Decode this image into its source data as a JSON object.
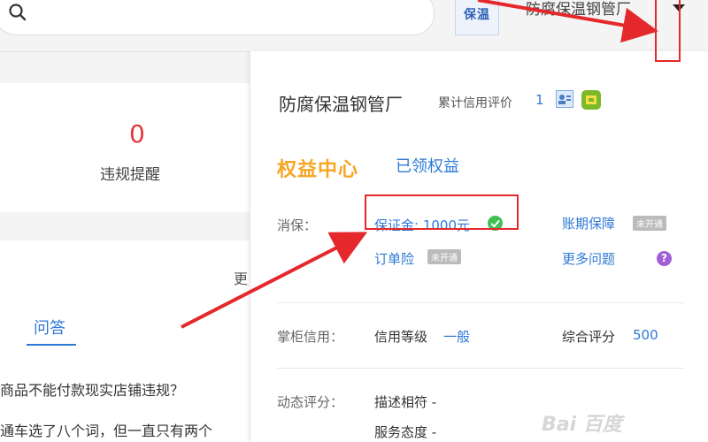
{
  "header": {
    "logo_text": "保温",
    "shop_name": "防腐保温钢管厂"
  },
  "left": {
    "violation_count": "0",
    "violation_label": "违规提醒",
    "more_link": "更",
    "tab_qa": "问答",
    "questions": [
      "商品不能付款现实店铺违规？",
      "通车选了八个词，但一直只有两个"
    ]
  },
  "panel": {
    "shop_name": "防腐保温钢管厂",
    "credit_label": "累计信用评价",
    "credit_value": "1",
    "benefits_title": "权益中心",
    "benefits_claimed": "已领权益",
    "xiaobao_label": "消保：",
    "deposit": "保证金: 1000元",
    "order_insurance": "订单险",
    "not_enabled": "未开通",
    "account_protection": "账期保障",
    "more_questions": "更多问题",
    "shopkeeper_credit_label": "掌柜信用：",
    "credit_level_label": "信用等级",
    "credit_level_value": "一般",
    "overall_score_label": "综合评分",
    "overall_score_value": "500",
    "dynamic_rating_label": "动态评分：",
    "desc_match": "描述相符 -",
    "service_attitude": "服务态度 -"
  },
  "watermark": "Bai 百度",
  "colors": {
    "accent_blue": "#2e79d6",
    "annotation_red": "#e5282b",
    "benefits_orange": "#f5a623",
    "count_red": "#e4393c"
  }
}
